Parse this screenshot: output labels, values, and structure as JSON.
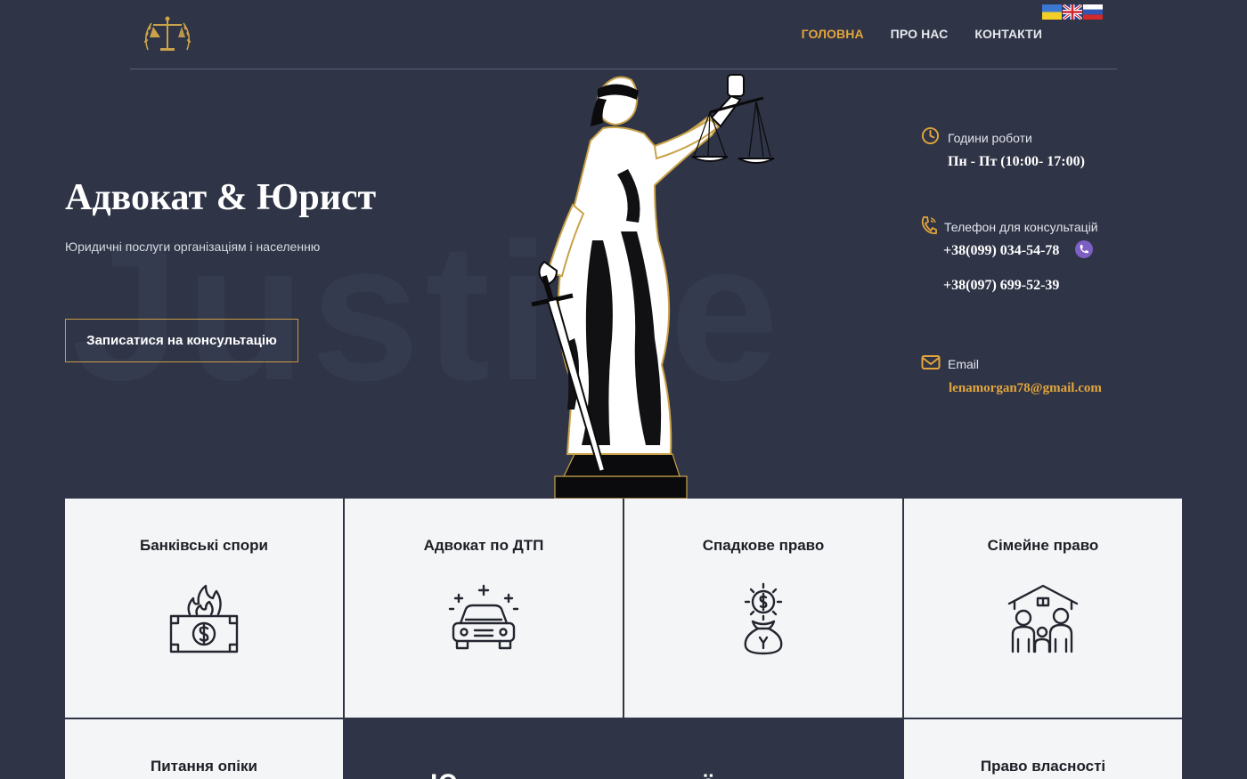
{
  "header": {
    "logo": "scales-of-justice-logo",
    "nav": [
      {
        "label": "ГОЛОВНА",
        "active": true
      },
      {
        "label": "ПРО НАС",
        "active": false
      },
      {
        "label": "КОНТАКТИ",
        "active": false
      }
    ],
    "languages": [
      "ua-flag",
      "uk-flag",
      "ru-flag"
    ]
  },
  "hero": {
    "watermark": "Justice",
    "title": "Адвокат & Юрист",
    "subtitle": "Юридичні послуги організаціям і населенню",
    "cta_label": "Записатися на консультацію"
  },
  "contact": {
    "hours_label": "Години роботи",
    "hours_value": "Пн - Пт (10:00- 17:00)",
    "phone_label": "Телефон для консультацій",
    "phone_1": "+38(099) 034-54-78",
    "phone_2": "+38(097) 699-52-39",
    "email_label": "Email",
    "email_value": "lenamorgan78@gmail.com"
  },
  "services": [
    {
      "title": "Банківські спори",
      "icon": "burning-money-icon"
    },
    {
      "title": "Адвокат по ДТП",
      "icon": "car-icon"
    },
    {
      "title": "Спадкове право",
      "icon": "money-bag-icon"
    },
    {
      "title": "Сімейне право",
      "icon": "family-home-icon"
    },
    {
      "title": "Питання опіки",
      "icon": ""
    },
    {
      "title": "Право власності",
      "icon": ""
    }
  ],
  "colors": {
    "background": "#2f3446",
    "accent": "#e3a63c",
    "card": "#f4f5f6"
  }
}
